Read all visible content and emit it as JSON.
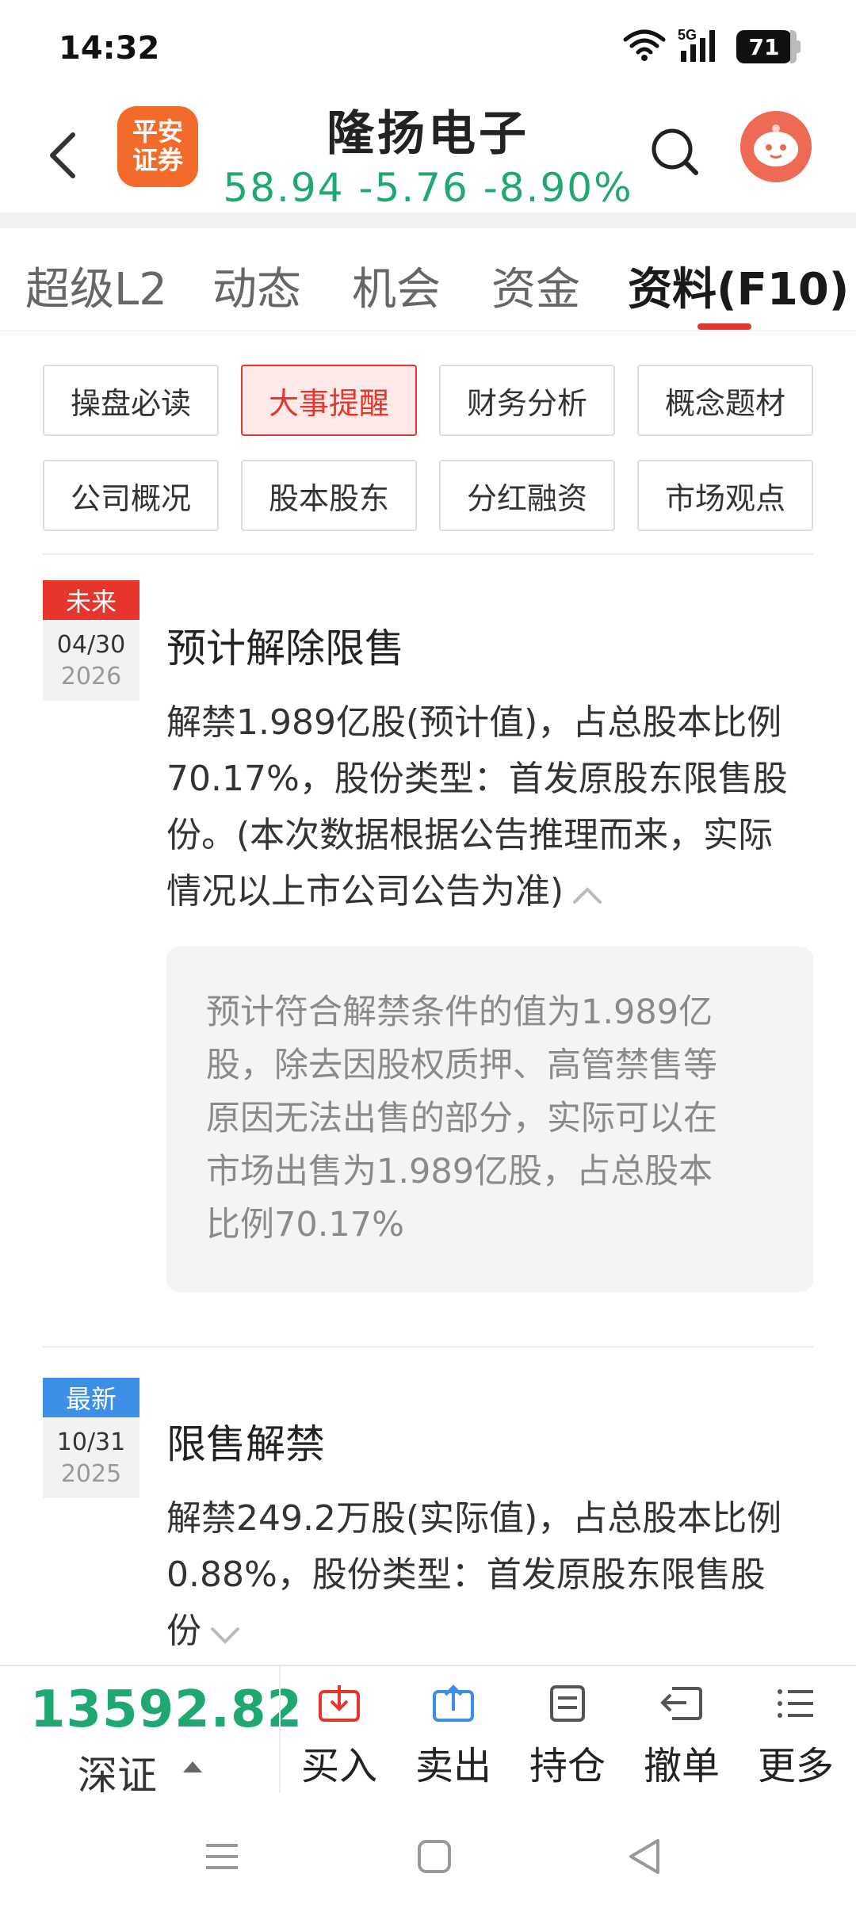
{
  "status": {
    "time": "14:32",
    "network": "5G",
    "battery": "71"
  },
  "header": {
    "logo_line1": "平安",
    "logo_line2": "证券",
    "stock_name": "隆扬电子",
    "quote": "58.94 -5.76 -8.90%",
    "quote_color": "#1fa971"
  },
  "tabs": [
    {
      "label": "超级L2"
    },
    {
      "label": "动态"
    },
    {
      "label": "机会"
    },
    {
      "label": "资金"
    },
    {
      "label": "资料(F10)"
    }
  ],
  "categories": [
    {
      "label": "操盘必读"
    },
    {
      "label": "大事提醒"
    },
    {
      "label": "财务分析"
    },
    {
      "label": "概念题材"
    },
    {
      "label": "公司概况"
    },
    {
      "label": "股本股东"
    },
    {
      "label": "分红融资"
    },
    {
      "label": "市场观点"
    }
  ],
  "events": [
    {
      "tag": "未来",
      "tag_color": "#e5352d",
      "date": "04/30",
      "year": "2026",
      "title": "预计解除限售",
      "lines": [
        "解禁1.989亿股(预计值)，占总股本比例",
        "70.17%，股份类型：首发原股东限售股",
        "份。(本次数据根据公告推理而来，实际",
        "情况以上市公司公告为准)"
      ],
      "note_lines": [
        "预计符合解禁条件的值为1.989亿",
        "股，除去因股权质押、高管禁售等",
        "原因无法出售的部分，实际可以在",
        "市场出售为1.989亿股，占总股本",
        "比例70.17%"
      ]
    },
    {
      "tag": "最新",
      "tag_color": "#3d8ee6",
      "date": "10/31",
      "year": "2025",
      "title": "限售解禁",
      "lines": [
        "解禁249.2万股(实际值)，占总股本比例",
        "0.88%，股份类型：首发原股东限售股",
        "份"
      ]
    }
  ],
  "bottom": {
    "index_value": "13592.82",
    "index_name": "深证",
    "actions": [
      {
        "label": "买入",
        "color": "#e5352d"
      },
      {
        "label": "卖出",
        "color": "#3d8ee6"
      },
      {
        "label": "持仓",
        "color": "#555555"
      },
      {
        "label": "撤单",
        "color": "#555555"
      },
      {
        "label": "更多",
        "color": "#555555"
      }
    ]
  }
}
